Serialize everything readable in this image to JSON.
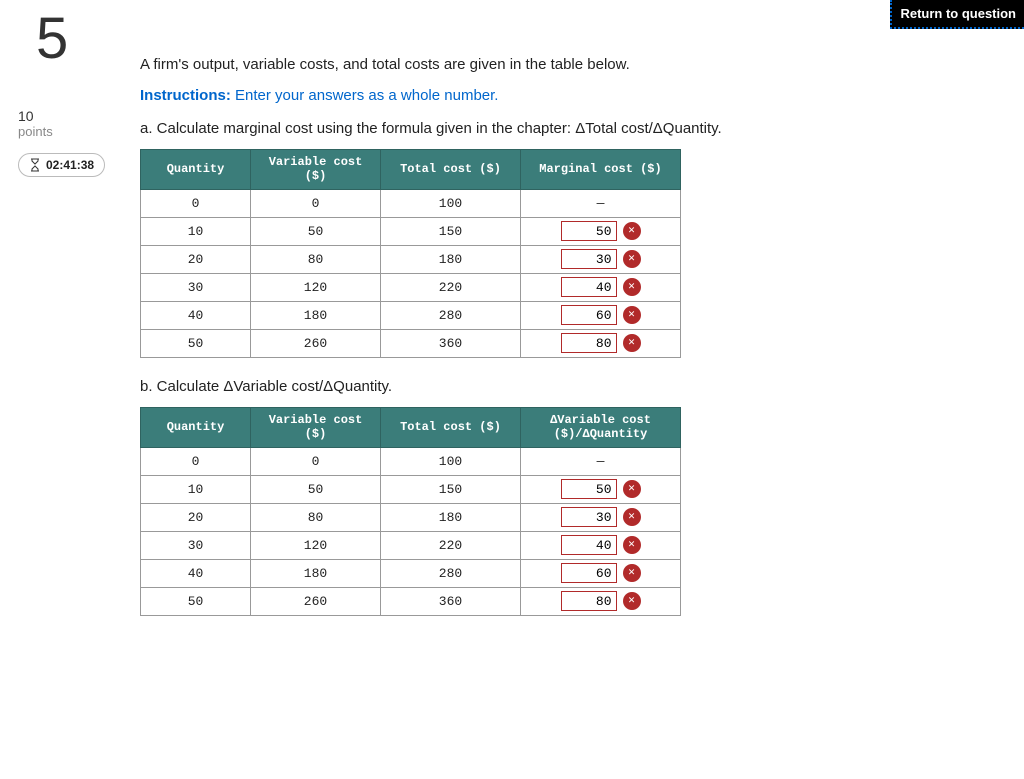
{
  "return_label": "Return to question",
  "sidebar": {
    "question_number": "5",
    "points_value": "10",
    "points_label": "points",
    "timer": "02:41:38"
  },
  "intro": "A firm's output, variable costs, and total costs are given in the table below.",
  "instructions_label": "Instructions:",
  "instructions_text": " Enter your answers as a whole number.",
  "part_a": "a. Calculate marginal cost using the formula given in the chapter: ΔTotal cost/ΔQuantity.",
  "part_b": "b. Calculate ΔVariable cost/ΔQuantity.",
  "table_a": {
    "headers": [
      "Quantity",
      "Variable cost ($)",
      "Total cost ($)",
      "Marginal cost ($)"
    ],
    "rows": [
      {
        "q": "0",
        "v": "0",
        "t": "100",
        "m": "—",
        "input": false
      },
      {
        "q": "10",
        "v": "50",
        "t": "150",
        "m": "50",
        "input": true,
        "wrong": true
      },
      {
        "q": "20",
        "v": "80",
        "t": "180",
        "m": "30",
        "input": true,
        "wrong": true
      },
      {
        "q": "30",
        "v": "120",
        "t": "220",
        "m": "40",
        "input": true,
        "wrong": true
      },
      {
        "q": "40",
        "v": "180",
        "t": "280",
        "m": "60",
        "input": true,
        "wrong": true
      },
      {
        "q": "50",
        "v": "260",
        "t": "360",
        "m": "80",
        "input": true,
        "wrong": true
      }
    ]
  },
  "table_b": {
    "headers": [
      "Quantity",
      "Variable cost ($)",
      "Total cost ($)",
      "ΔVariable cost ($)/ΔQuantity"
    ],
    "rows": [
      {
        "q": "0",
        "v": "0",
        "t": "100",
        "m": "—",
        "input": false
      },
      {
        "q": "10",
        "v": "50",
        "t": "150",
        "m": "50",
        "input": true,
        "wrong": true
      },
      {
        "q": "20",
        "v": "80",
        "t": "180",
        "m": "30",
        "input": true,
        "wrong": true
      },
      {
        "q": "30",
        "v": "120",
        "t": "220",
        "m": "40",
        "input": true,
        "wrong": true
      },
      {
        "q": "40",
        "v": "180",
        "t": "280",
        "m": "60",
        "input": true,
        "wrong": true
      },
      {
        "q": "50",
        "v": "260",
        "t": "360",
        "m": "80",
        "input": true,
        "wrong": true
      }
    ]
  }
}
